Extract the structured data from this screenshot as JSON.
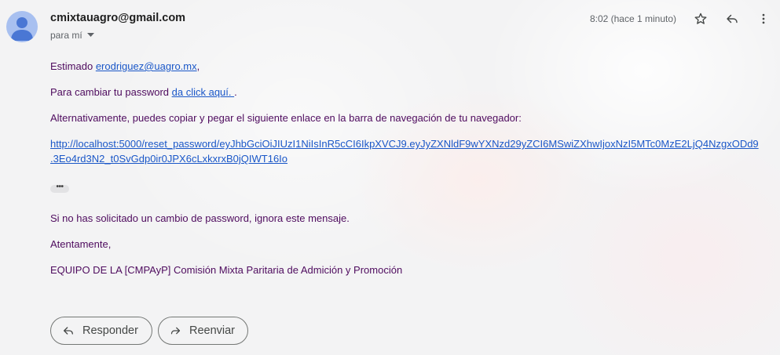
{
  "header": {
    "sender": "cmixtauagro@gmail.com",
    "recipient": "para mí",
    "timestamp": "8:02 (hace 1 minuto)"
  },
  "icons": {
    "avatar": "person-avatar-icon",
    "recipient_toggle": "dropdown-caret-icon",
    "star": "star-icon",
    "reply": "reply-icon",
    "more": "more-vert-icon",
    "forward": "forward-icon"
  },
  "message": {
    "greeting_prefix": "Estimado ",
    "greeting_email": "erodriguez@uagro.mx",
    "greeting_suffix": ",",
    "change_prefix": "Para cambiar tu password ",
    "change_link": "da click aquí. ",
    "change_suffix": ".",
    "alternative": "Alternativamente, puedes copiar y pegar el siguiente enlace en la barra de navegación de tu navegador:",
    "reset_url_line1": "http://localhost:5000/reset_password/eyJhbGciOiJIUzI1NiIsInR5cCI6IkpXVCJ9.eyJyZXNldF9wYXNzd29yZCI6MSwiZXhwIjoxNzI5MTc0MzE2LjQ4NzgxODd9",
    "reset_url_line2": ".3Eo4rd3N2_t0SvGdp0ir0JPX6cLxkxrxB0jQIWT16Io",
    "ellipsis": "•••",
    "ignore": "Si no has solicitado un cambio de password, ignora este mensaje.",
    "closing": "Atentamente,",
    "signature": "EQUIPO DE LA [CMPAyP] Comisión Mixta Paritaria de Admición y Promoción"
  },
  "actions": {
    "reply_label": "Responder",
    "forward_label": "Reenviar"
  },
  "colors": {
    "body_text": "#4e0b5e",
    "link": "#1a57c8",
    "avatar_bg": "#a8c0f0",
    "avatar_fg": "#4a77d4"
  }
}
